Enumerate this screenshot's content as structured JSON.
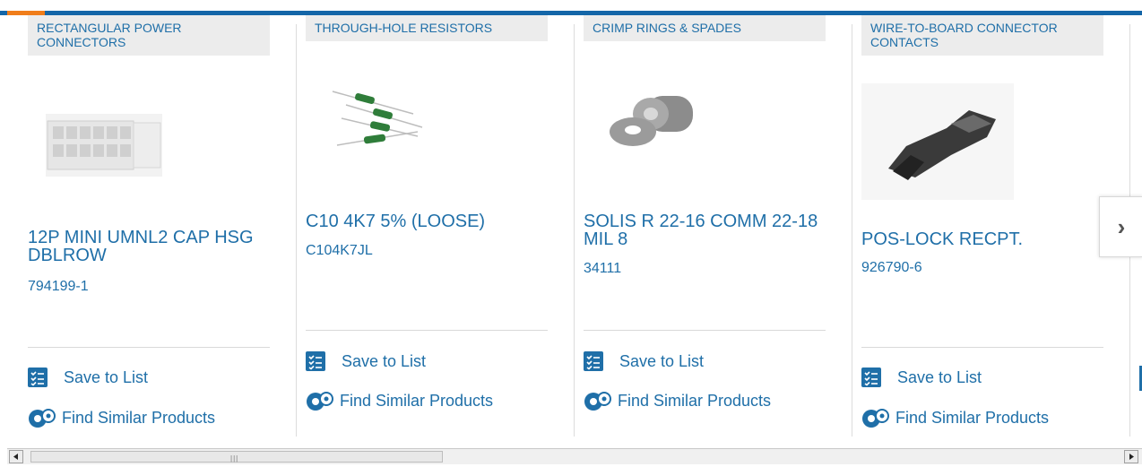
{
  "colors": {
    "accent": "#1466a8",
    "highlight": "#f07d1a",
    "link": "#1f6fa8"
  },
  "products": [
    {
      "category": "RECTANGULAR POWER CONNECTORS",
      "name": "12P MINI UMNL2 CAP HSG DBLROW",
      "number": "794199-1",
      "image_icon": "connector-housing-image",
      "save_label": "Save to List",
      "similar_label": "Find Similar Products"
    },
    {
      "category": "THROUGH-HOLE RESISTORS",
      "name": "C10 4K7 5% (LOOSE)",
      "number": "C104K7JL",
      "image_icon": "resistor-image",
      "save_label": "Save to List",
      "similar_label": "Find Similar Products"
    },
    {
      "category": "CRIMP RINGS & SPADES",
      "name": "SOLIS R 22-16 COMM 22-18 MIL 8",
      "number": "34111",
      "image_icon": "ring-terminal-image",
      "save_label": "Save to List",
      "similar_label": "Find Similar Products"
    },
    {
      "category": "WIRE-TO-BOARD CONNECTOR CONTACTS",
      "name": "POS-LOCK RECPT.",
      "number": "926790-6",
      "image_icon": "contact-image",
      "save_label": "Save to List",
      "similar_label": "Find Similar Products"
    }
  ],
  "carousel": {
    "next_icon": "chevron-right-icon",
    "next_glyph": "›"
  },
  "scrollbar": {
    "left_icon": "scroll-left-icon",
    "right_icon": "scroll-right-icon"
  }
}
